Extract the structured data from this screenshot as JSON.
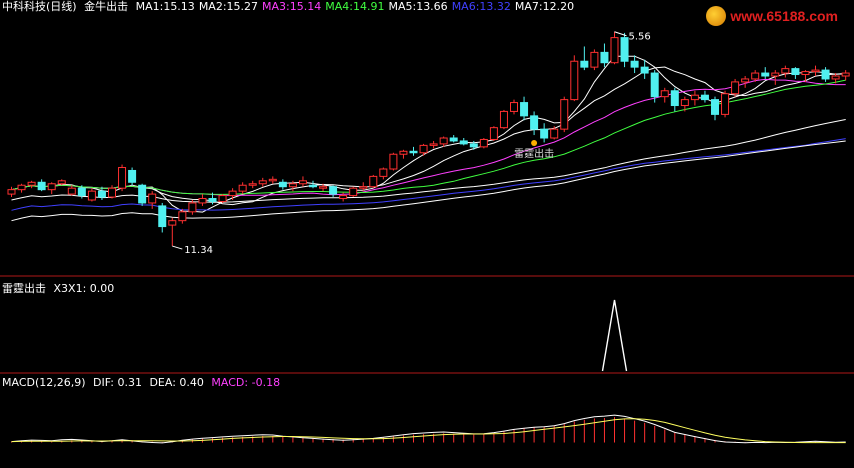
{
  "main_header": {
    "title": "中科科技(日线)",
    "indicator": "金牛出击",
    "ma": [
      {
        "label": "MA1:",
        "value": "15.13",
        "color": "#ffffff"
      },
      {
        "label": "MA2:",
        "value": "15.27",
        "color": "#ffffff"
      },
      {
        "label": "MA3:",
        "value": "15.14",
        "color": "#ff40ff"
      },
      {
        "label": "MA4:",
        "value": "14.91",
        "color": "#40ff40"
      },
      {
        "label": "MA5:",
        "value": "13.66",
        "color": "#ffffff"
      },
      {
        "label": "MA6:",
        "value": "13.32",
        "color": "#4040ff"
      },
      {
        "label": "MA7:",
        "value": "12.20",
        "color": "#ffffff"
      }
    ]
  },
  "watermark": {
    "text": "www.65188.com"
  },
  "sub_header": {
    "name": "雷霆出击",
    "indicator": "X3X1:",
    "value": "0.00"
  },
  "macd_header": {
    "name": "MACD(12,26,9)",
    "dif_label": "DIF:",
    "dif": "0.31",
    "dea_label": "DEA:",
    "dea": "0.40",
    "macd_label": "MACD:",
    "macd": "-0.18",
    "macd_color": "#ff40ff"
  },
  "annotations": {
    "high": "5.56",
    "low": "11.34",
    "signal": "雷霆出击"
  },
  "colors": {
    "up": "#ff3030",
    "down": "#50f0f0",
    "bg": "#000000",
    "separator": "#b01818"
  },
  "chart_data": {
    "type": "candlestick",
    "y_unit": "price",
    "candles": [
      [
        13.1,
        13.35,
        13.0,
        13.25
      ],
      [
        13.25,
        13.45,
        13.15,
        13.4
      ],
      [
        13.4,
        13.55,
        13.3,
        13.5
      ],
      [
        13.5,
        13.6,
        13.2,
        13.25
      ],
      [
        13.25,
        13.5,
        13.1,
        13.45
      ],
      [
        13.45,
        13.6,
        13.4,
        13.55
      ],
      [
        13.1,
        13.4,
        13.05,
        13.3
      ],
      [
        13.3,
        13.4,
        12.95,
        13.05
      ],
      [
        12.9,
        13.3,
        12.85,
        13.2
      ],
      [
        13.2,
        13.35,
        12.9,
        13.0
      ],
      [
        13.0,
        13.4,
        12.95,
        13.3
      ],
      [
        13.3,
        14.1,
        13.2,
        14.0
      ],
      [
        13.9,
        14.0,
        13.4,
        13.5
      ],
      [
        13.4,
        13.45,
        12.7,
        12.8
      ],
      [
        12.8,
        13.2,
        12.6,
        13.1
      ],
      [
        12.7,
        12.8,
        11.8,
        12.0
      ],
      [
        12.05,
        12.3,
        11.34,
        12.2
      ],
      [
        12.2,
        12.6,
        12.1,
        12.5
      ],
      [
        12.5,
        12.9,
        12.4,
        12.8
      ],
      [
        12.8,
        13.1,
        12.7,
        12.95
      ],
      [
        12.95,
        13.15,
        12.75,
        12.85
      ],
      [
        12.85,
        13.1,
        12.8,
        13.05
      ],
      [
        13.05,
        13.3,
        12.9,
        13.2
      ],
      [
        13.2,
        13.5,
        13.1,
        13.4
      ],
      [
        13.4,
        13.55,
        13.3,
        13.45
      ],
      [
        13.45,
        13.65,
        13.35,
        13.55
      ],
      [
        13.55,
        13.7,
        13.45,
        13.6
      ],
      [
        13.5,
        13.6,
        13.25,
        13.35
      ],
      [
        13.35,
        13.55,
        13.2,
        13.45
      ],
      [
        13.45,
        13.7,
        13.35,
        13.55
      ],
      [
        13.4,
        13.55,
        13.3,
        13.35
      ],
      [
        13.3,
        13.45,
        13.2,
        13.35
      ],
      [
        13.35,
        13.4,
        13.0,
        13.1
      ],
      [
        12.95,
        13.15,
        12.85,
        13.05
      ],
      [
        13.05,
        13.35,
        13.0,
        13.3
      ],
      [
        13.3,
        13.5,
        13.2,
        13.35
      ],
      [
        13.35,
        13.75,
        13.3,
        13.7
      ],
      [
        13.7,
        14.0,
        13.6,
        13.95
      ],
      [
        13.95,
        14.5,
        13.9,
        14.45
      ],
      [
        14.45,
        14.6,
        14.3,
        14.55
      ],
      [
        14.55,
        14.7,
        14.4,
        14.5
      ],
      [
        14.5,
        14.8,
        14.4,
        14.75
      ],
      [
        14.75,
        14.9,
        14.65,
        14.8
      ],
      [
        14.8,
        15.05,
        14.7,
        15.0
      ],
      [
        15.0,
        15.1,
        14.85,
        14.9
      ],
      [
        14.9,
        15.0,
        14.75,
        14.8
      ],
      [
        14.8,
        14.9,
        14.6,
        14.7
      ],
      [
        14.7,
        15.0,
        14.65,
        14.95
      ],
      [
        14.95,
        15.4,
        14.9,
        15.35
      ],
      [
        15.35,
        15.95,
        15.3,
        15.9
      ],
      [
        15.9,
        16.3,
        15.8,
        16.2
      ],
      [
        16.2,
        16.4,
        15.6,
        15.75
      ],
      [
        15.75,
        15.9,
        15.1,
        15.3
      ],
      [
        15.3,
        15.5,
        14.85,
        15.0
      ],
      [
        15.0,
        15.4,
        14.95,
        15.3
      ],
      [
        15.3,
        16.4,
        15.2,
        16.3
      ],
      [
        16.3,
        17.8,
        16.25,
        17.6
      ],
      [
        17.6,
        18.1,
        17.3,
        17.4
      ],
      [
        17.4,
        18.0,
        17.3,
        17.9
      ],
      [
        17.9,
        18.2,
        17.4,
        17.55
      ],
      [
        17.55,
        18.6,
        17.5,
        18.4
      ],
      [
        18.4,
        18.56,
        17.4,
        17.6
      ],
      [
        17.6,
        17.8,
        17.2,
        17.4
      ],
      [
        17.4,
        17.65,
        17.0,
        17.2
      ],
      [
        17.2,
        17.3,
        16.2,
        16.4
      ],
      [
        16.4,
        16.7,
        16.2,
        16.6
      ],
      [
        16.6,
        16.7,
        15.9,
        16.1
      ],
      [
        16.1,
        16.4,
        15.9,
        16.3
      ],
      [
        16.3,
        16.6,
        16.1,
        16.45
      ],
      [
        16.45,
        16.6,
        16.2,
        16.3
      ],
      [
        16.3,
        16.4,
        15.6,
        15.8
      ],
      [
        15.8,
        16.6,
        15.7,
        16.5
      ],
      [
        16.5,
        17.0,
        16.4,
        16.9
      ],
      [
        16.9,
        17.1,
        16.7,
        17.0
      ],
      [
        17.0,
        17.3,
        16.9,
        17.2
      ],
      [
        17.2,
        17.4,
        17.0,
        17.1
      ],
      [
        17.1,
        17.3,
        16.8,
        17.2
      ],
      [
        17.2,
        17.45,
        17.05,
        17.35
      ],
      [
        17.35,
        17.4,
        17.0,
        17.15
      ],
      [
        17.15,
        17.3,
        16.9,
        17.25
      ],
      [
        17.25,
        17.45,
        17.1,
        17.3
      ],
      [
        17.3,
        17.4,
        16.9,
        17.0
      ],
      [
        17.0,
        17.2,
        16.85,
        17.1
      ],
      [
        17.1,
        17.3,
        16.95,
        17.2
      ]
    ],
    "marker": {
      "index": 60,
      "value": 1
    },
    "signal_index": 52,
    "macd_bars": [
      0.02,
      0.03,
      0.04,
      0.03,
      0.02,
      0.04,
      0.05,
      0.04,
      0.03,
      0.02,
      0.04,
      0.07,
      0.05,
      0.03,
      0.02,
      0.01,
      0.03,
      0.06,
      0.08,
      0.09,
      0.1,
      0.11,
      0.12,
      0.13,
      0.14,
      0.15,
      0.15,
      0.13,
      0.12,
      0.11,
      0.1,
      0.09,
      0.08,
      0.07,
      0.08,
      0.09,
      0.1,
      0.12,
      0.14,
      0.16,
      0.18,
      0.19,
      0.2,
      0.21,
      0.2,
      0.19,
      0.18,
      0.19,
      0.22,
      0.26,
      0.3,
      0.33,
      0.35,
      0.36,
      0.38,
      0.42,
      0.48,
      0.52,
      0.55,
      0.56,
      0.58,
      0.55,
      0.5,
      0.45,
      0.38,
      0.3,
      0.22,
      0.18,
      0.14,
      0.1,
      0.06,
      0.03,
      0.02,
      0.01,
      0.01,
      0.0,
      0.0,
      -0.01,
      -0.01,
      0.0,
      0.01,
      0.0,
      -0.01,
      0.0
    ],
    "macd_range": [
      -0.4,
      1.2
    ]
  }
}
